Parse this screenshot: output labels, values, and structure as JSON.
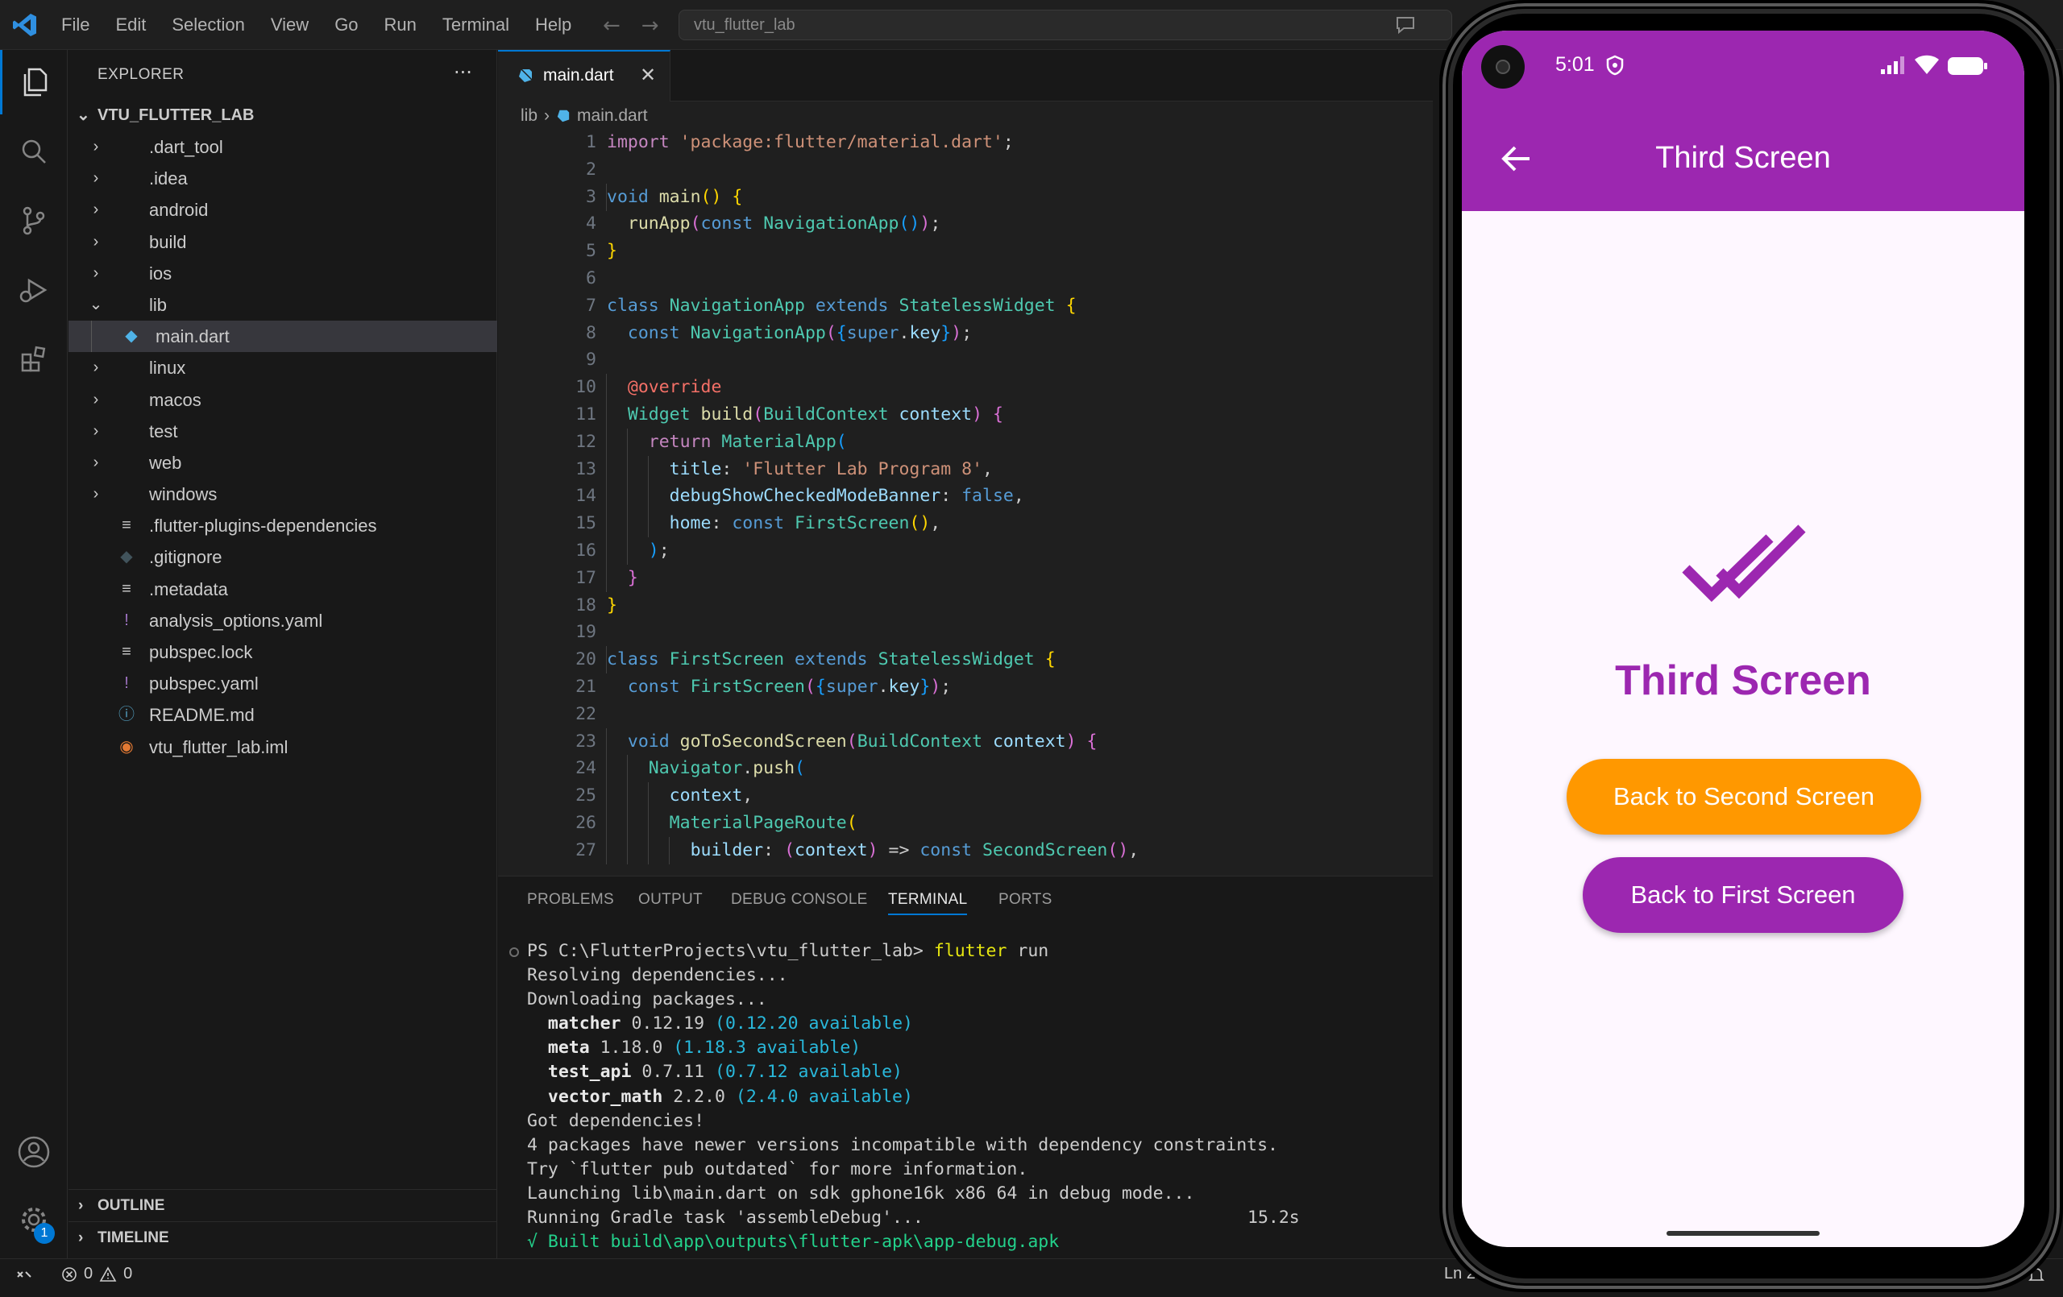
{
  "menu": [
    "File",
    "Edit",
    "Selection",
    "View",
    "Go",
    "Run",
    "Terminal",
    "Help"
  ],
  "command_center": "vtu_flutter_lab",
  "explorer": {
    "title": "EXPLORER",
    "project": "VTU_FLUTTER_LAB",
    "items": [
      {
        "label": ".dart_tool",
        "kind": "folder",
        "depth": 0
      },
      {
        "label": ".idea",
        "kind": "folder",
        "depth": 0
      },
      {
        "label": "android",
        "kind": "folder",
        "depth": 0
      },
      {
        "label": "build",
        "kind": "folder",
        "depth": 0
      },
      {
        "label": "ios",
        "kind": "folder",
        "depth": 0
      },
      {
        "label": "lib",
        "kind": "folder-open",
        "depth": 0
      },
      {
        "label": "main.dart",
        "kind": "dart",
        "depth": 1
      },
      {
        "label": "linux",
        "kind": "folder",
        "depth": 0
      },
      {
        "label": "macos",
        "kind": "folder",
        "depth": 0
      },
      {
        "label": "test",
        "kind": "folder",
        "depth": 0
      },
      {
        "label": "web",
        "kind": "folder",
        "depth": 0
      },
      {
        "label": "windows",
        "kind": "folder",
        "depth": 0
      },
      {
        "label": ".flutter-plugins-dependencies",
        "kind": "lines",
        "depth": 0
      },
      {
        "label": ".gitignore",
        "kind": "git",
        "depth": 0
      },
      {
        "label": ".metadata",
        "kind": "lines",
        "depth": 0
      },
      {
        "label": "analysis_options.yaml",
        "kind": "yaml",
        "depth": 0
      },
      {
        "label": "pubspec.lock",
        "kind": "lines",
        "depth": 0
      },
      {
        "label": "pubspec.yaml",
        "kind": "yaml",
        "depth": 0
      },
      {
        "label": "README.md",
        "kind": "info",
        "depth": 0
      },
      {
        "label": "vtu_flutter_lab.iml",
        "kind": "rss",
        "depth": 0
      }
    ],
    "outline": "OUTLINE",
    "timeline": "TIMELINE"
  },
  "editor": {
    "tab": "main.dart",
    "breadcrumb": [
      "lib",
      "main.dart"
    ],
    "lines": [
      [
        [
          "import ",
          "kw"
        ],
        [
          "'package:flutter/material.dart'",
          "str"
        ],
        [
          ";",
          "pl"
        ]
      ],
      [],
      [
        [
          "void ",
          "bl"
        ],
        [
          "main",
          "fn"
        ],
        [
          "() ",
          "y1"
        ],
        [
          "{",
          "y1"
        ]
      ],
      [
        [
          "  ",
          "pl"
        ],
        [
          "runApp",
          "fn"
        ],
        [
          "(",
          "p2"
        ],
        [
          "const ",
          "bl"
        ],
        [
          "NavigationApp",
          "cls"
        ],
        [
          "()",
          "b3"
        ],
        [
          ")",
          "p2"
        ],
        [
          ";",
          "pl"
        ]
      ],
      [
        [
          "}",
          "y1"
        ]
      ],
      [],
      [
        [
          "class ",
          "bl"
        ],
        [
          "NavigationApp ",
          "cls"
        ],
        [
          "extends ",
          "bl"
        ],
        [
          "StatelessWidget ",
          "cls"
        ],
        [
          "{",
          "y1"
        ]
      ],
      [
        [
          "  ",
          "pl"
        ],
        [
          "const ",
          "bl"
        ],
        [
          "NavigationApp",
          "cls"
        ],
        [
          "(",
          "p2"
        ],
        [
          "{",
          "b3"
        ],
        [
          "super",
          "bl"
        ],
        [
          ".",
          "pl"
        ],
        [
          "key",
          "var"
        ],
        [
          "}",
          "b3"
        ],
        [
          ")",
          "p2"
        ],
        [
          ";",
          "pl"
        ]
      ],
      [],
      [
        [
          "  ",
          "pl"
        ],
        [
          "@override",
          "ann"
        ]
      ],
      [
        [
          "  ",
          "pl"
        ],
        [
          "Widget ",
          "cls"
        ],
        [
          "build",
          "fn"
        ],
        [
          "(",
          "p2"
        ],
        [
          "BuildContext ",
          "cls"
        ],
        [
          "context",
          "var"
        ],
        [
          ") ",
          "p2"
        ],
        [
          "{",
          "p2"
        ]
      ],
      [
        [
          "    ",
          "pl"
        ],
        [
          "return ",
          "kw"
        ],
        [
          "MaterialApp",
          "cls"
        ],
        [
          "(",
          "b3"
        ]
      ],
      [
        [
          "      ",
          "pl"
        ],
        [
          "title",
          "var"
        ],
        [
          ": ",
          "pl"
        ],
        [
          "'Flutter Lab Program 8'",
          "str"
        ],
        [
          ",",
          "pl"
        ]
      ],
      [
        [
          "      ",
          "pl"
        ],
        [
          "debugShowCheckedModeBanner",
          "var"
        ],
        [
          ": ",
          "pl"
        ],
        [
          "false",
          "bl"
        ],
        [
          ",",
          "pl"
        ]
      ],
      [
        [
          "      ",
          "pl"
        ],
        [
          "home",
          "var"
        ],
        [
          ": ",
          "pl"
        ],
        [
          "const ",
          "bl"
        ],
        [
          "FirstScreen",
          "cls"
        ],
        [
          "()",
          "y1"
        ],
        [
          ",",
          "pl"
        ]
      ],
      [
        [
          "    ",
          "pl"
        ],
        [
          ")",
          "b3"
        ],
        [
          ";",
          "pl"
        ]
      ],
      [
        [
          "  ",
          "pl"
        ],
        [
          "}",
          "p2"
        ]
      ],
      [
        [
          "}",
          "y1"
        ]
      ],
      [],
      [
        [
          "class ",
          "bl"
        ],
        [
          "FirstScreen ",
          "cls"
        ],
        [
          "extends ",
          "bl"
        ],
        [
          "StatelessWidget ",
          "cls"
        ],
        [
          "{",
          "y1"
        ]
      ],
      [
        [
          "  ",
          "pl"
        ],
        [
          "const ",
          "bl"
        ],
        [
          "FirstScreen",
          "cls"
        ],
        [
          "(",
          "p2"
        ],
        [
          "{",
          "b3"
        ],
        [
          "super",
          "bl"
        ],
        [
          ".",
          "pl"
        ],
        [
          "key",
          "var"
        ],
        [
          "}",
          "b3"
        ],
        [
          ")",
          "p2"
        ],
        [
          ";",
          "pl"
        ]
      ],
      [],
      [
        [
          "  ",
          "pl"
        ],
        [
          "void ",
          "bl"
        ],
        [
          "goToSecondScreen",
          "fn"
        ],
        [
          "(",
          "p2"
        ],
        [
          "BuildContext ",
          "cls"
        ],
        [
          "context",
          "var"
        ],
        [
          ") ",
          "p2"
        ],
        [
          "{",
          "p2"
        ]
      ],
      [
        [
          "    ",
          "pl"
        ],
        [
          "Navigator",
          "cls"
        ],
        [
          ".",
          "pl"
        ],
        [
          "push",
          "fn"
        ],
        [
          "(",
          "b3"
        ]
      ],
      [
        [
          "      ",
          "pl"
        ],
        [
          "context",
          "var"
        ],
        [
          ",",
          "pl"
        ]
      ],
      [
        [
          "      ",
          "pl"
        ],
        [
          "MaterialPageRoute",
          "cls"
        ],
        [
          "(",
          "y1"
        ]
      ],
      [
        [
          "        ",
          "pl"
        ],
        [
          "builder",
          "var"
        ],
        [
          ": ",
          "pl"
        ],
        [
          "(",
          "p2"
        ],
        [
          "context",
          "var"
        ],
        [
          ") ",
          "p2"
        ],
        [
          "=> ",
          "pl"
        ],
        [
          "const ",
          "bl"
        ],
        [
          "SecondScreen",
          "cls"
        ],
        [
          "()",
          "p2"
        ],
        [
          ",",
          "pl"
        ]
      ]
    ]
  },
  "panel": {
    "tabs": [
      "PROBLEMS",
      "OUTPUT",
      "DEBUG CONSOLE",
      "TERMINAL",
      "PORTS"
    ],
    "active_tab": "TERMINAL",
    "terminal": [
      [
        [
          "PS C:\\FlutterProjects\\vtu_flutter_lab> ",
          "pl"
        ],
        [
          "flutter ",
          "cmd"
        ],
        [
          "run",
          "pl"
        ]
      ],
      [
        [
          "Resolving dependencies...",
          "pl"
        ]
      ],
      [
        [
          "Downloading packages...",
          "pl"
        ]
      ],
      [
        [
          "  matcher ",
          "bold"
        ],
        [
          "0.12.19 ",
          "pl"
        ],
        [
          "(0.12.20 available)",
          "cy"
        ]
      ],
      [
        [
          "  meta ",
          "bold"
        ],
        [
          "1.18.0 ",
          "pl"
        ],
        [
          "(1.18.3 available)",
          "cy"
        ]
      ],
      [
        [
          "  test_api ",
          "bold"
        ],
        [
          "0.7.11 ",
          "pl"
        ],
        [
          "(0.7.12 available)",
          "cy"
        ]
      ],
      [
        [
          "  vector_math ",
          "bold"
        ],
        [
          "2.2.0 ",
          "pl"
        ],
        [
          "(2.4.0 available)",
          "cy"
        ]
      ],
      [
        [
          "Got dependencies!",
          "pl"
        ]
      ],
      [
        [
          "4 packages have newer versions incompatible with dependency constraints.",
          "pl"
        ]
      ],
      [
        [
          "Try `flutter pub outdated` for more information.",
          "pl"
        ]
      ],
      [
        [
          "Launching lib\\main.dart on sdk gphone16k x86 64 in debug mode...",
          "pl"
        ]
      ],
      [
        [
          "Running Gradle task 'assembleDebug'...",
          "pl"
        ]
      ],
      [
        [
          "√ Built build\\app\\outputs\\flutter-apk\\app-debug.apk",
          "gr"
        ]
      ]
    ],
    "gradle_time": "15.2s"
  },
  "status": {
    "errors": "0",
    "warnings": "0",
    "position": "Ln 2"
  },
  "phone": {
    "time": "5:01",
    "appbar_title": "Third Screen",
    "heading": "Third Screen",
    "button_second": "Back to Second Screen",
    "button_first": "Back to First Screen",
    "primary_color": "#9c27b0",
    "accent_color": "#ff9800",
    "background_color": "#fef7ff",
    "icon": "done-all-icon"
  },
  "theme": {
    "kw": "#c586c0",
    "str": "#ce9178",
    "bl": "#569cd6",
    "fn": "#dcdcaa",
    "cls": "#4ec9b0",
    "var": "#9cdcfe",
    "pl": "#cccccc",
    "ann": "#f47067",
    "y1": "#ffd700",
    "p2": "#da70d6",
    "b3": "#179fff",
    "cmd": "#e5e510",
    "bold": "#e8e8e8",
    "cy": "#29b8db",
    "gr": "#23d18b"
  }
}
